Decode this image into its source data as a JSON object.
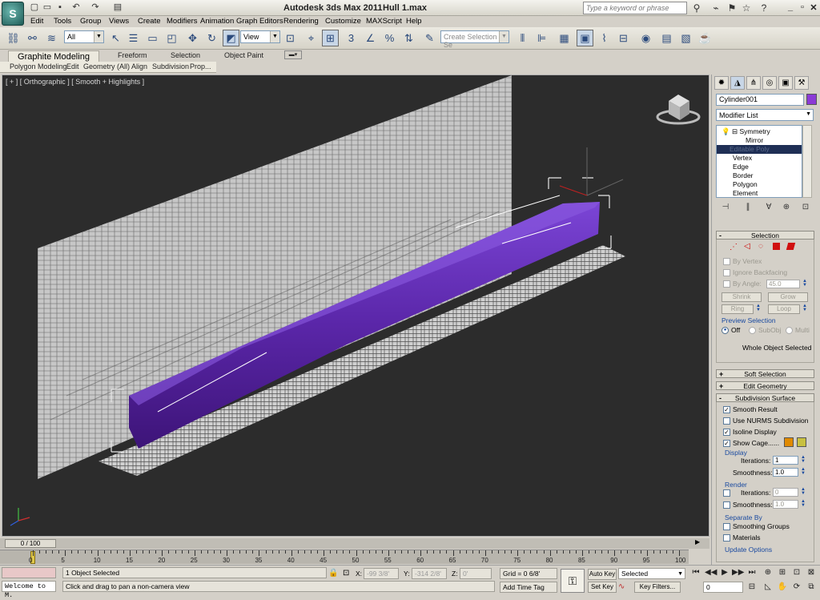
{
  "app": {
    "title": "Autodesk 3ds Max  2011",
    "file": "Hull 1.max",
    "logo_text": "S",
    "search_placeholder": "Type a keyword or phrase",
    "quick_access": [
      "new-file-icon",
      "open-file-icon",
      "save-icon",
      "undo-icon",
      "redo-icon",
      "project-folder-icon"
    ]
  },
  "menu": [
    "Edit",
    "Tools",
    "Group",
    "Views",
    "Create",
    "Modifiers",
    "Animation",
    "Graph Editors",
    "Rendering",
    "Customize",
    "MAXScript",
    "Help"
  ],
  "toolbar": {
    "filter_value": "All",
    "refcoord_value": "View",
    "selection_set_placeholder": "Create Selection Se",
    "snap_label": "3"
  },
  "ribbon": {
    "tabs": [
      "Graphite Modeling Tools",
      "Freeform",
      "Selection",
      "Object Paint"
    ],
    "subtabs": [
      "Polygon Modeling",
      "Edit",
      "Geometry (All)",
      "Align",
      "Subdivision",
      "Prop..."
    ]
  },
  "viewport": {
    "label": "[ + ] [ Orthographic ] [ Smooth + Highlights ]",
    "hull_color": "#6a2fc0",
    "background": "#2c2c2c"
  },
  "panel": {
    "object_name": "Cylinder001",
    "object_color": "#8a3ad6",
    "modifier_list": "Modifier List",
    "stack": [
      "Symmetry",
      "Mirror",
      "Editable Poly",
      "Vertex",
      "Edge",
      "Border",
      "Polygon",
      "Element"
    ],
    "selection": {
      "header": "Selection",
      "by_vertex": "By Vertex",
      "ignore_backfacing": "Ignore Backfacing",
      "by_angle": "By Angle:",
      "angle_value": "45.0",
      "shrink": "Shrink",
      "grow": "Grow",
      "ring": "Ring",
      "loop": "Loop",
      "preview_label": "Preview Selection",
      "off": "Off",
      "subobj": "SubObj",
      "multi": "Multi",
      "status": "Whole Object Selected"
    },
    "soft_selection": "Soft Selection",
    "edit_geometry": "Edit Geometry",
    "subdivision": {
      "header": "Subdivision Surface",
      "smooth_result": "Smooth Result",
      "use_nurms": "Use NURMS Subdivision",
      "isoline": "Isoline Display",
      "show_cage": "Show Cage......",
      "display_label": "Display",
      "iterations_label": "Iterations:",
      "iterations_value": "1",
      "smoothness_label": "Smoothness:",
      "smoothness_value": "1.0",
      "render_label": "Render",
      "r_iterations_value": "0",
      "r_smoothness_value": "1.0",
      "separate_label": "Separate By",
      "smoothing_groups": "Smoothing Groups",
      "materials": "Materials",
      "update_options": "Update Options",
      "cage_color1": "#e08a00",
      "cage_color2": "#c8c040"
    }
  },
  "timeline": {
    "slider": "0 / 100",
    "ticks": [
      "0",
      "5",
      "10",
      "15",
      "20",
      "25",
      "30",
      "35",
      "40",
      "45",
      "50",
      "55",
      "60",
      "65",
      "70",
      "75",
      "80",
      "85",
      "90",
      "95",
      "100"
    ]
  },
  "status": {
    "script": "Welcome to M.",
    "selected": "1 Object Selected",
    "prompt": "Click and drag to pan a non-camera view",
    "x_label": "X:",
    "x_value": "-99 3/8'",
    "y_label": "Y:",
    "y_value": "-314 2/8'",
    "z_label": "Z:",
    "z_value": "0'",
    "grid": "Grid = 0 6/8'",
    "add_time_tag": "Add Time Tag",
    "auto_key": "Auto Key",
    "set_key": "Set Key",
    "key_mode": "Selected",
    "key_filters": "Key Filters...",
    "frame": "0"
  }
}
